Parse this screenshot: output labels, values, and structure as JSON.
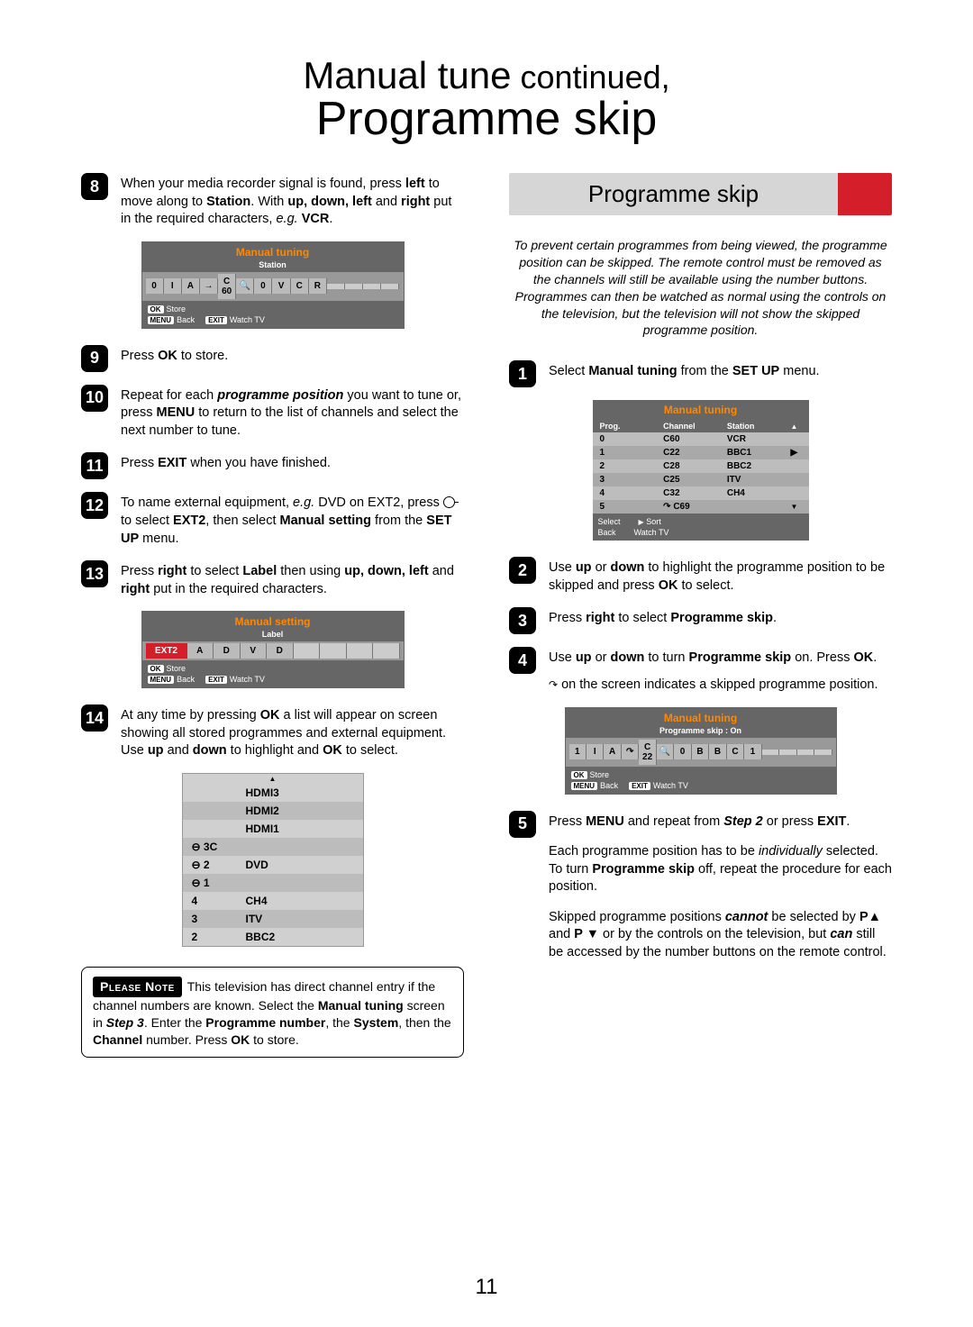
{
  "page_number": "11",
  "title": {
    "line1_main": "Manual tune",
    "line1_sub": "continued,",
    "line2": "Programme skip"
  },
  "left": {
    "steps": {
      "s8": "When your media recorder signal is found, press <b>left</b> to move along to <b>Station</b>. With <b>up, down, left</b> and <b>right</b> put in the required characters, <i>e.g.</i> <b>VCR</b>.",
      "s9": "Press <b>OK</b> to store.",
      "s10": "Repeat for each <b><i>programme position</i></b> you want to tune or, press <b>MENU</b> to return to the list of channels and select the next number to tune.",
      "s11": "Press <b>EXIT</b> when you have finished.",
      "s12": "To name external equipment, <i>e.g.</i> DVD on EXT2, press <span class='ext-icon' data-name='ext-icon'></span> to select <b>EXT2</b>, then select <b>Manual setting</b> from the <b>SET UP</b> menu.",
      "s13": "Press <b>right</b> to select <b>Label</b> then using <b>up, down, left</b> and <b>right</b> put in the required characters.",
      "s14": "At any time by pressing <b>OK</b> a list will appear on screen showing all stored programmes and external equipment. Use <b>up</b> and <b>down</b> to highlight and <b>OK</b> to select."
    },
    "osd1": {
      "title": "Manual tuning",
      "subtitle": "Station",
      "cells": [
        "0",
        "I",
        "A",
        "→",
        "C 60",
        "🔍",
        "0",
        "V",
        "C",
        "R",
        "",
        "",
        "",
        ""
      ],
      "footer": {
        "store": "Store",
        "back": "Back",
        "watch": "Watch TV"
      }
    },
    "osd2": {
      "title": "Manual setting",
      "subtitle": "Label",
      "ext_label": "EXT2",
      "cells": [
        "A",
        "D",
        "V",
        "D",
        "",
        "",
        "",
        ""
      ],
      "footer": {
        "store": "Store",
        "back": "Back",
        "watch": "Watch TV"
      }
    },
    "inputs": {
      "rows": [
        [
          "",
          "HDMI3"
        ],
        [
          "",
          "HDMI2"
        ],
        [
          "",
          "HDMI1"
        ],
        [
          "⊖ 3C",
          ""
        ],
        [
          "⊖ 2",
          "DVD"
        ],
        [
          "⊖ 1",
          ""
        ],
        [
          "4",
          "CH4"
        ],
        [
          "3",
          "ITV"
        ],
        [
          "2",
          "BBC2"
        ]
      ]
    },
    "note": {
      "label": "Please Note",
      "text": "This television has direct channel entry if the channel numbers are known. Select the <b>Manual tuning</b> screen in <b><i>Step 3</i></b>. Enter the <b>Programme number</b>, the <b>System</b>, then the <b>Channel</b> number. Press <b>OK</b> to store."
    }
  },
  "right": {
    "section_title": "Programme skip",
    "intro": "To prevent certain programmes from being viewed, the programme position can be skipped. The remote control must be removed as the channels will still be available using the number buttons. Programmes can then be watched as normal using the controls on the television, but the television will not show the skipped programme position.",
    "steps": {
      "s1": "Select <b>Manual tuning</b> from the <b>SET UP</b> menu.",
      "s2": "Use <b>up</b> or <b>down</b> to highlight the programme position to be skipped and press <b>OK</b> to select.",
      "s3": "Press <b>right</b> to select <b>Programme skip</b>.",
      "s4": "Use <b>up</b> or <b>down</b> to turn <b>Programme skip</b> on. Press <b>OK</b>.",
      "s4b": "<span class='skip-ind' data-name='skip-indicator-icon'></span> on the screen indicates a skipped programme position.",
      "s5": "Press <b>MENU</b> and repeat from <b><i>Step 2</i></b> or press <b>EXIT</b>.",
      "s5b": "Each programme position has to be <i>individually</i> selected. To turn <b>Programme skip</b> off, repeat the procedure for each position.",
      "s5c": "Skipped programme positions <b><i>cannot</i></b> be selected by <b>P▲</b> and <b>P ▼</b> or by the controls on the television, but <b><i>can</i></b> still be accessed by the number buttons on the remote control."
    },
    "chan_table": {
      "title": "Manual tuning",
      "head": [
        "Prog.",
        "Channel",
        "Station"
      ],
      "rows": [
        [
          "0",
          "C60",
          "VCR",
          ""
        ],
        [
          "1",
          "C22",
          "BBC1",
          "▶"
        ],
        [
          "2",
          "C28",
          "BBC2",
          ""
        ],
        [
          "3",
          "C25",
          "ITV",
          ""
        ],
        [
          "4",
          "C32",
          "CH4",
          ""
        ],
        [
          "5",
          "↷ C69",
          "",
          ""
        ]
      ],
      "footer": {
        "select": "Select",
        "sort": "Sort",
        "back": "Back",
        "watch": "Watch TV"
      }
    },
    "osd3": {
      "title": "Manual tuning",
      "subtitle": "Programme skip : On",
      "cells": [
        "1",
        "I",
        "A",
        "↷",
        "C 22",
        "🔍",
        "0",
        "B",
        "B",
        "C",
        "1",
        "",
        "",
        "",
        ""
      ],
      "footer": {
        "store": "Store",
        "back": "Back",
        "watch": "Watch TV"
      }
    }
  }
}
